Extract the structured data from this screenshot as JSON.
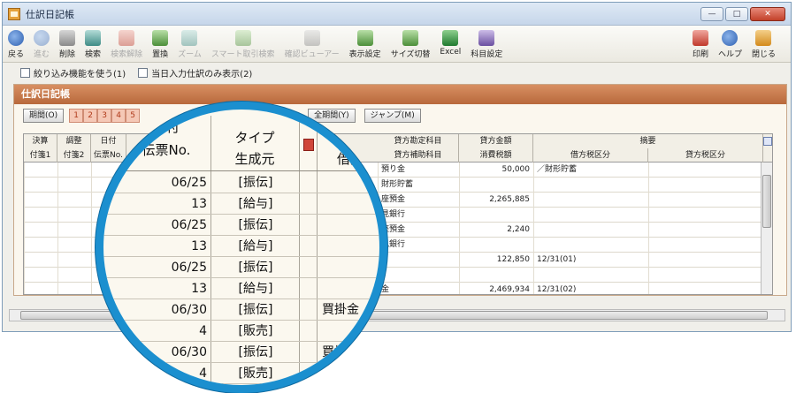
{
  "window": {
    "title": "仕訳日記帳",
    "minimize": "—",
    "maximize": "□",
    "close": "✕"
  },
  "toolbar": {
    "left": [
      {
        "label": "戻る",
        "icon": "back-arrow-icon",
        "color": "blue",
        "disabled": false
      },
      {
        "label": "進む",
        "icon": "forward-arrow-icon",
        "color": "blue",
        "disabled": true
      },
      {
        "label": "削除",
        "icon": "trash-icon",
        "color": "gray",
        "disabled": false
      },
      {
        "label": "検索",
        "icon": "magnifier-icon",
        "color": "teal",
        "disabled": false
      },
      {
        "label": "検索解除",
        "icon": "search-clear-icon",
        "color": "red",
        "disabled": true
      },
      {
        "label": "置換",
        "icon": "replace-icon",
        "color": "green",
        "disabled": false
      },
      {
        "label": "ズーム",
        "icon": "zoom-icon",
        "color": "teal",
        "disabled": true
      },
      {
        "label": "スマート取引検索",
        "icon": "smart-search-icon",
        "color": "green",
        "disabled": true
      },
      {
        "label": "確認ビューアー",
        "icon": "viewer-icon",
        "color": "gray",
        "disabled": true
      },
      {
        "label": "表示設定",
        "icon": "display-settings-icon",
        "color": "green",
        "disabled": false
      },
      {
        "label": "サイズ切替",
        "icon": "size-toggle-icon",
        "color": "green",
        "disabled": false
      },
      {
        "label": "Excel",
        "icon": "excel-icon",
        "color": "excel",
        "disabled": false
      },
      {
        "label": "科目設定",
        "icon": "account-settings-icon",
        "color": "purple",
        "disabled": false
      }
    ],
    "right": [
      {
        "label": "印刷",
        "icon": "printer-icon",
        "color": "red",
        "disabled": false
      },
      {
        "label": "ヘルプ",
        "icon": "help-icon",
        "color": "blue",
        "disabled": false
      },
      {
        "label": "閉じる",
        "icon": "exit-door-icon",
        "color": "orange",
        "disabled": false
      }
    ]
  },
  "options": {
    "filter_label": "絞り込み機能を使う(1)",
    "today_label": "当日入力仕訳のみ表示(2)"
  },
  "panel": {
    "title": "仕訳日記帳",
    "period_button": "期間(O)",
    "months": [
      "1",
      "2",
      "3",
      "4",
      "5"
    ],
    "all_period_button": "全期間(Y)",
    "jump_button": "ジャンプ(M)"
  },
  "grid": {
    "headers_top": {
      "kessan": "決算",
      "chousei": "調整",
      "hizuke": "日付",
      "credit_account": "貸方勘定科目",
      "credit_amount": "貸方金額",
      "tekiyou": "摘要"
    },
    "headers_bottom": {
      "fusen1": "付箋1",
      "fusen2": "付箋2",
      "denpyo": "伝票No.",
      "credit_sub": "貸方補助科目",
      "tax": "消費税額",
      "debit_tax": "借方税区分",
      "credit_tax": "貸方税区分"
    },
    "rows": [
      {
        "account": "預り金",
        "amount": "50,000",
        "memo": "／財形貯蓄"
      },
      {
        "account": "財形貯蓄",
        "amount": "",
        "memo": ""
      },
      {
        "account": "座預金",
        "amount": "2,265,885",
        "memo": ""
      },
      {
        "account": "見銀行",
        "amount": "",
        "memo": ""
      },
      {
        "account": "座預金",
        "amount": "2,240",
        "memo": ""
      },
      {
        "account": "見銀行",
        "amount": "",
        "memo": ""
      },
      {
        "account": "",
        "amount": "122,850",
        "memo": "12/31(01)"
      },
      {
        "account": "",
        "amount": "",
        "memo": ""
      },
      {
        "account": "金",
        "amount": "2,469,934",
        "memo": "12/31(02)"
      }
    ]
  },
  "magnifier": {
    "header_date": "日付",
    "header_voucher": "伝票No.",
    "header_type": "タイプ",
    "header_source": "生成元",
    "header_debit": "借方",
    "rows": [
      {
        "left": "06/25",
        "right": "[振伝]",
        "extra": ""
      },
      {
        "left": "13",
        "right": "[給与]",
        "extra": ""
      },
      {
        "left": "06/25",
        "right": "[振伝]",
        "extra": ""
      },
      {
        "left": "13",
        "right": "[給与]",
        "extra": ""
      },
      {
        "left": "06/25",
        "right": "[振伝]",
        "extra": ""
      },
      {
        "left": "13",
        "right": "[給与]",
        "extra": ""
      },
      {
        "left": "06/30",
        "right": "[振伝]",
        "extra": "買掛金"
      },
      {
        "left": "4",
        "right": "[販売]",
        "extra": ""
      },
      {
        "left": "06/30",
        "right": "[振伝]",
        "extra": "買掛"
      },
      {
        "left": "4",
        "right": "[販売]",
        "extra": ""
      }
    ]
  },
  "colors": {
    "magnifier_ring": "#1b8fcf",
    "panel_header": "#c07445",
    "month_tab": "#f5c8b6"
  }
}
